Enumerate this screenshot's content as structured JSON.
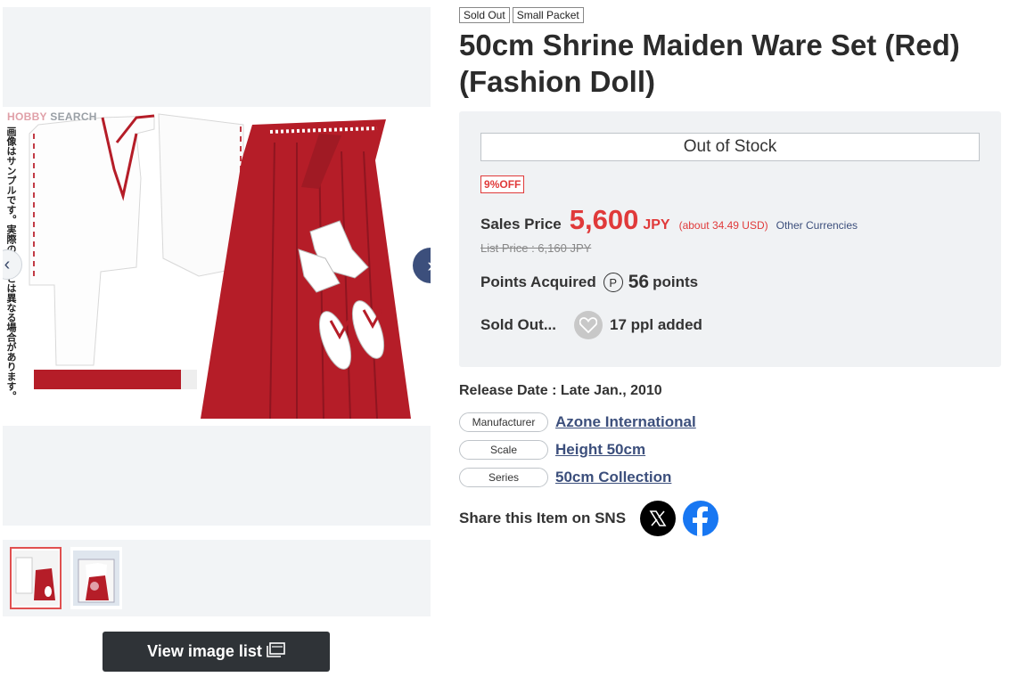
{
  "gallery": {
    "watermark_prefix": "H",
    "watermark_mid": "BBY",
    "watermark_word": "SEARCH",
    "side_notice": "画像はサンプルです。実際の商品とは異なる場合があります。",
    "prev_icon": "chevron-left-icon",
    "next_icon": "chevron-right-icon",
    "view_list_label": "View image list",
    "view_list_icon": "gallery-icon"
  },
  "product": {
    "badges": [
      "Sold Out",
      "Small Packet"
    ],
    "title": "50cm Shrine Maiden Ware Set (Red) (Fashion Doll)",
    "stock_status": "Out of Stock",
    "discount_num": "9",
    "discount_suffix": "%OFF",
    "sales_price_label": "Sales Price",
    "price": "5,600",
    "price_unit": "JPY",
    "price_usd": "(about 34.49 USD)",
    "other_currencies": "Other Currencies",
    "list_price": "List Price : 6,160 JPY",
    "points_label": "Points Acquired",
    "points_icon_letter": "P",
    "points_value": "56",
    "points_unit": "points",
    "wish_label": "Sold Out...",
    "wish_count": "17 ppl added",
    "release": "Release Date : Late Jan., 2010",
    "specs": [
      {
        "tag": "Manufacturer",
        "value": "Azone International"
      },
      {
        "tag": "Scale",
        "value": "Height 50cm"
      },
      {
        "tag": "Series",
        "value": "50cm Collection"
      }
    ],
    "share_label": "Share this Item on SNS"
  },
  "colors": {
    "accent_red": "#e03a3a",
    "navy": "#3c4f7c",
    "hakama_red": "#b51d28",
    "facebook": "#1877f2"
  }
}
